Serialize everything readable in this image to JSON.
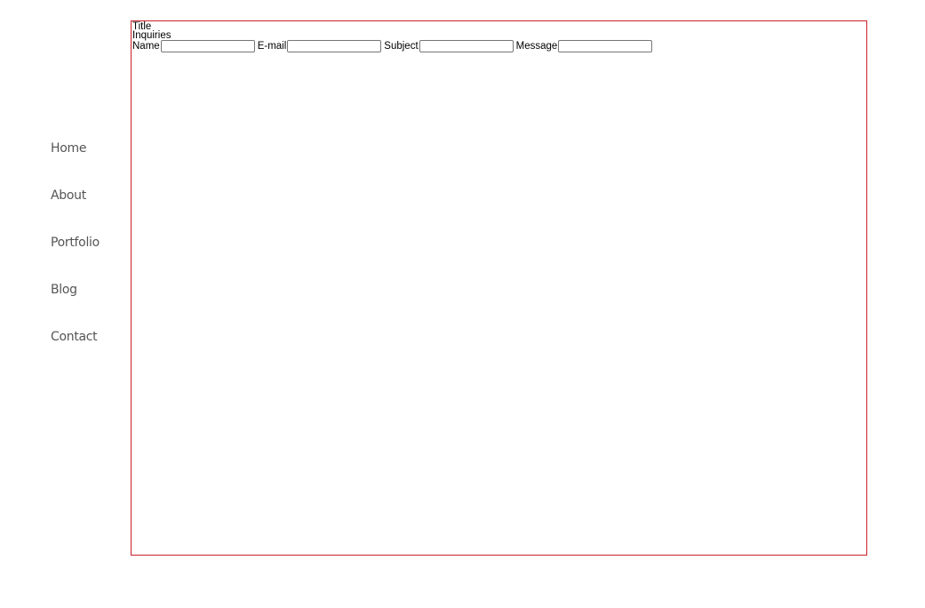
{
  "nav": {
    "items": [
      {
        "label": "Home"
      },
      {
        "label": "About"
      },
      {
        "label": "Portfolio"
      },
      {
        "label": "Blog"
      },
      {
        "label": "Contact"
      }
    ]
  },
  "content": {
    "title": "Title",
    "heading": "Inquiries",
    "form": {
      "name_label": "Name",
      "email_label": "E-mail",
      "subject_label": "Subject",
      "message_label": "Message",
      "name_value": "",
      "email_value": "",
      "subject_value": "",
      "message_value": ""
    }
  },
  "colors": {
    "frame_border": "#c8202a",
    "nav_text": "#555555"
  }
}
